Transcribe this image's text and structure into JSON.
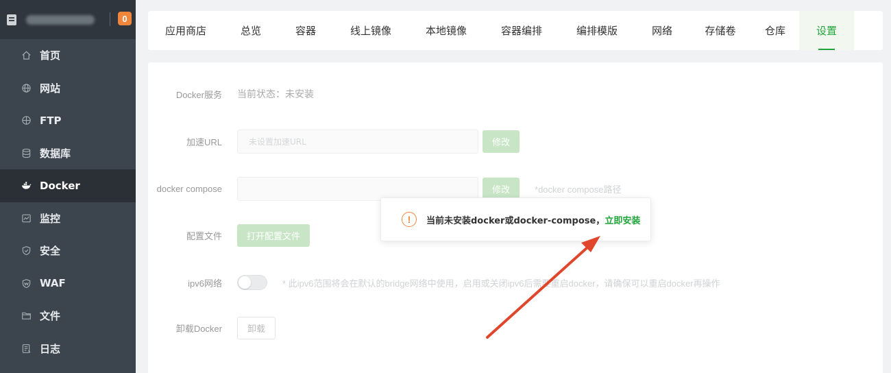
{
  "sidebar": {
    "badge": "0",
    "items": [
      {
        "label": "首页",
        "icon": "home-icon"
      },
      {
        "label": "网站",
        "icon": "globe-icon"
      },
      {
        "label": "FTP",
        "icon": "ftp-globe-icon"
      },
      {
        "label": "数据库",
        "icon": "database-icon"
      },
      {
        "label": "Docker",
        "icon": "docker-icon",
        "active": true
      },
      {
        "label": "监控",
        "icon": "monitor-icon"
      },
      {
        "label": "安全",
        "icon": "shield-icon"
      },
      {
        "label": "WAF",
        "icon": "waf-shield-icon"
      },
      {
        "label": "文件",
        "icon": "folder-icon"
      },
      {
        "label": "日志",
        "icon": "log-icon"
      }
    ]
  },
  "tabs": [
    "应用商店",
    "总览",
    "容器",
    "线上镜像",
    "本地镜像",
    "容器编排",
    "编排模版",
    "网络",
    "存储卷",
    "仓库",
    "设置"
  ],
  "active_tab": "设置",
  "settings": {
    "docker_service_label": "Docker服务",
    "docker_status": "当前状态：未安装",
    "accel_url_label": "加速URL",
    "accel_url_placeholder": "未设置加速URL",
    "modify_label": "修改",
    "compose_label": "docker compose",
    "compose_value": "",
    "compose_hint": "*docker compose路径",
    "config_file_label": "配置文件",
    "open_config_button": "打开配置文件",
    "ipv6_label": "ipv6网络",
    "ipv6_enabled": false,
    "ipv6_hint": "* 此ipv6范围将会在默认的bridge网络中使用，启用或关闭ipv6后需要重启docker，请确保可以重启docker再操作",
    "uninstall_label": "卸载Docker",
    "uninstall_button": "卸载"
  },
  "popup": {
    "icon": "warning-icon",
    "message": "当前未安装docker或docker-compose，",
    "link": "立即安装"
  },
  "colors": {
    "accent": "#20a53a",
    "warning": "#f0863c",
    "sidebar": "#3c444d",
    "arrow": "#e0462c"
  }
}
